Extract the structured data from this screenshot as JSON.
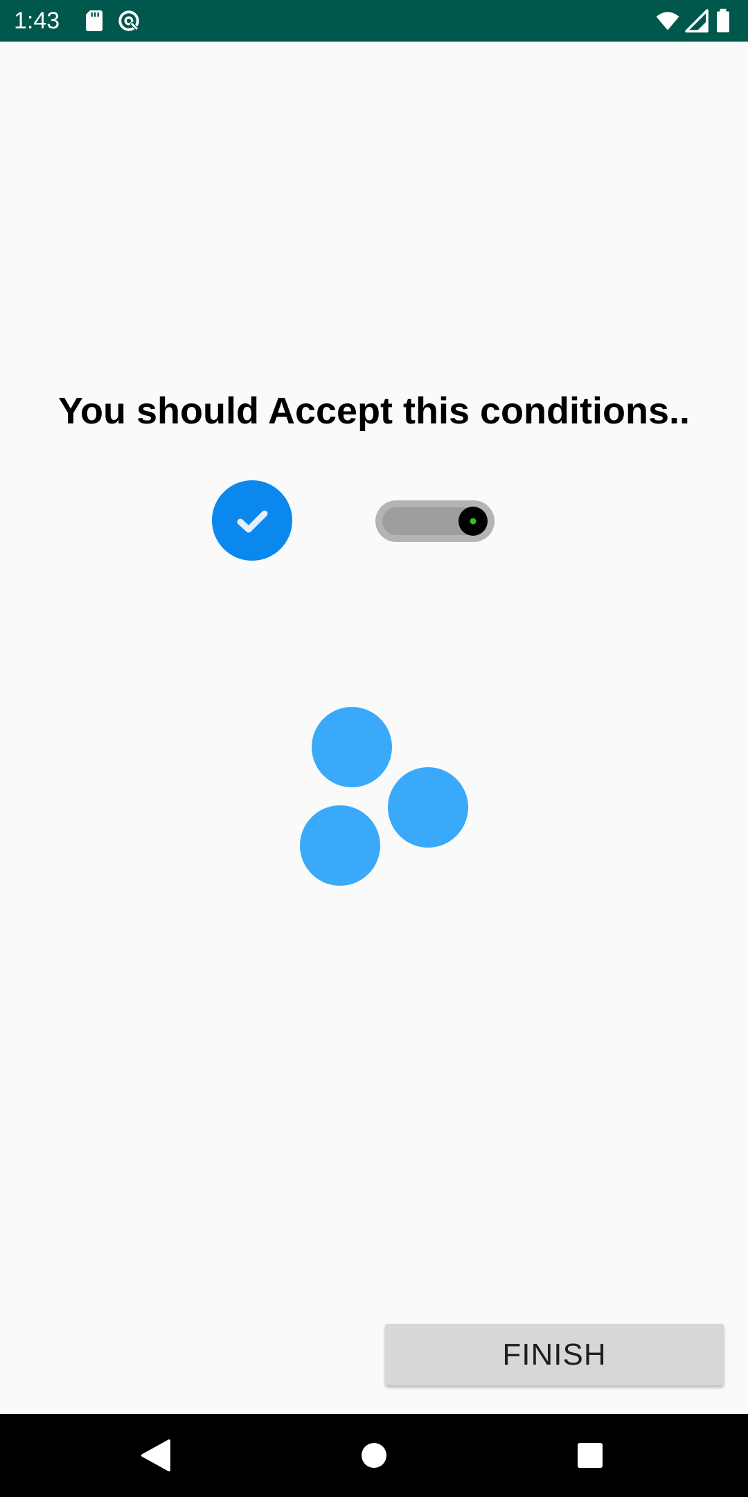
{
  "status_bar": {
    "time": "1:43",
    "background": "#00574b",
    "icons_left": [
      "sd-card-icon",
      "data-saver-icon"
    ],
    "icons_right": [
      "wifi-icon",
      "cell-signal-icon",
      "battery-icon"
    ]
  },
  "main": {
    "title": "You should Accept this conditions..",
    "checkbox": {
      "checked": true,
      "color": "#0a88ee",
      "icon": "checkmark-icon"
    },
    "switch": {
      "state": "on",
      "track_color": "#9e9e9e",
      "thumb_color": "#000000",
      "dot_color": "#35c11d"
    },
    "loader": {
      "icon": "three-dot-loader",
      "color": "#3aa9f9"
    },
    "finish_button": {
      "label": "FINISH",
      "background": "#d7d7d7"
    }
  },
  "nav_bar": {
    "background": "#000000",
    "buttons": [
      "back-icon",
      "home-icon",
      "recents-icon"
    ]
  }
}
